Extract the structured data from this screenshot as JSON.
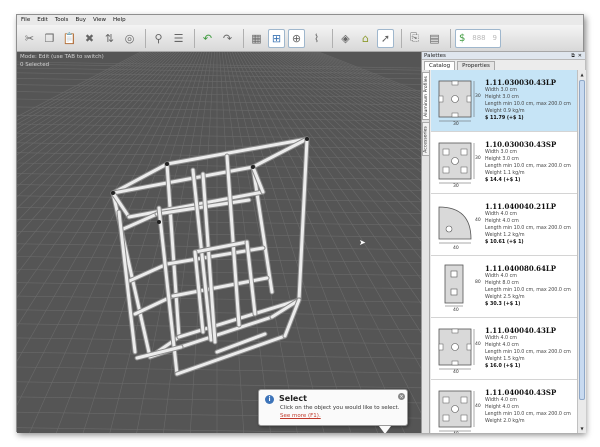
{
  "menu": [
    "File",
    "Edit",
    "Tools",
    "Buy",
    "View",
    "Help"
  ],
  "toolbar": {
    "counter": "888",
    "counter_suffix": "9",
    "icons": [
      "cut-icon",
      "copy-icon",
      "paste-icon",
      "delete-icon",
      "align-icon",
      "rotate-icon",
      "tag-icon",
      "list-icon",
      "undo-icon",
      "redo-icon",
      "grid-color-icon",
      "connect-icon",
      "move-nodes-icon",
      "bend-icon",
      "layers-icon",
      "home-view-icon",
      "select-arrow-icon",
      "export-icon",
      "document-icon",
      "price-tag-icon"
    ]
  },
  "viewport": {
    "mode_line": "Mode: Edit (use TAB to switch)",
    "selection_line": "0 Selected"
  },
  "popup": {
    "title": "Select",
    "text": "Click on the object you would like to select.",
    "link": "See more (F1)."
  },
  "palette": {
    "title": "Palettes",
    "tabs": [
      "Catalog",
      "Properties"
    ],
    "side_tabs": [
      "Aluminum Profiles",
      "Accessories"
    ],
    "items": [
      {
        "title": "1.11.030030.43LP",
        "width": "Width 3.0 cm",
        "height": "Height 3.0 cm",
        "length": "Length min 10.0 cm, max 200.0 cm",
        "weight": "Weight 0.9 kg/m",
        "price": "$ 11.79 (+$ 1)",
        "dim_w": "30",
        "dim_h": "30"
      },
      {
        "title": "1.10.030030.43SP",
        "width": "Width 3.0 cm",
        "height": "Height 3.0 cm",
        "length": "Length min 10.0 cm, max 200.0 cm",
        "weight": "Weight 1.1 kg/m",
        "price": "$ 14.4 (+$ 1)",
        "dim_w": "30",
        "dim_h": "30"
      },
      {
        "title": "1.11.040040.21LP",
        "width": "Width 4.0 cm",
        "height": "Height 4.0 cm",
        "length": "Length min 10.0 cm, max 200.0 cm",
        "weight": "Weight 1.2 kg/m",
        "price": "$ 10.61 (+$ 1)",
        "dim_w": "40",
        "dim_h": "40"
      },
      {
        "title": "1.11.040080.64LP",
        "width": "Width 4.0 cm",
        "height": "Height 8.0 cm",
        "length": "Length min 10.0 cm, max 200.0 cm",
        "weight": "Weight 2.5 kg/m",
        "price": "$ 30.3 (+$ 1)",
        "dim_w": "40",
        "dim_h": "80"
      },
      {
        "title": "1.11.040040.43LP",
        "width": "Width 4.0 cm",
        "height": "Height 4.0 cm",
        "length": "Length min 10.0 cm, max 200.0 cm",
        "weight": "Weight 1.5 kg/m",
        "price": "$ 16.0 (+$ 1)",
        "dim_w": "40",
        "dim_h": "40"
      },
      {
        "title": "1.11.040040.43SP",
        "width": "Width 4.0 cm",
        "height": "Height 4.0 cm",
        "length": "Length min 10.0 cm, max 200.0 cm",
        "weight": "Weight 2.0 kg/m",
        "price": "",
        "dim_w": "40",
        "dim_h": "40"
      }
    ]
  }
}
